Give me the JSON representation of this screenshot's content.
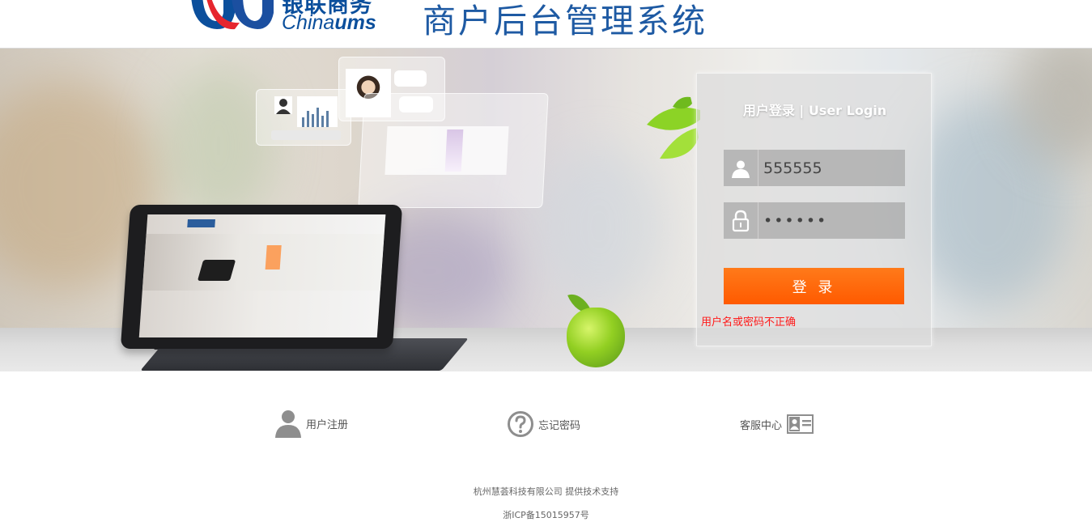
{
  "header": {
    "logo_cn": "银联商务",
    "logo_en_light": "China",
    "logo_en_bold": "ums",
    "system_title": "商户后台管理系统"
  },
  "login": {
    "title": "用户登录 | User Login",
    "username_value": "555555",
    "password_value": "••••••",
    "button_label": "登 录",
    "error_message": "用户名或密码不正确"
  },
  "links": {
    "register": "用户注册",
    "forgot_password": "忘记密码",
    "customer_service": "客服中心"
  },
  "footer": {
    "support": "杭州慧荟科技有限公司 提供技术支持",
    "icp": "浙ICP备15015957号"
  },
  "colors": {
    "brand_blue": "#1e5aa3",
    "button_orange": "#ff6a00",
    "error_red": "#ff1a1a"
  },
  "icons": [
    "user-icon",
    "lock-icon",
    "register-user-icon",
    "question-icon",
    "id-card-icon"
  ]
}
